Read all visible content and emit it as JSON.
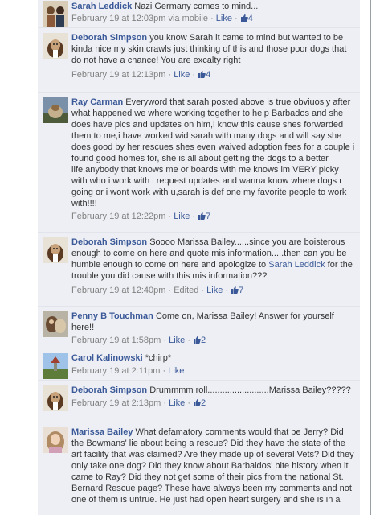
{
  "comments": [
    {
      "author": "Sarah Leddick",
      "text": "Nazi Germany comes to mind...",
      "meta": {
        "date": "February 19 at 12:03pm",
        "via": "via mobile",
        "like": "Like",
        "likes": "4"
      }
    },
    {
      "author": "Deborah Simpson",
      "text": "you know Sarah it came to mind but wanted to be kinda nice my skin crawls just thinking of this and those poor dogs that do not have a chance! You are excalty right",
      "meta": {
        "date": "February 19 at 12:13pm",
        "like": "Like",
        "likes": "4"
      }
    },
    {
      "author": "Ray Carman",
      "text": "Everyword that sarah posted above is true obviuosly after what happened we where working together to help Barbados and she does have pics and updates on him,i know this cause shes forwarded them to me,i have worked wid sarah with many dogs and will say she does good by her rescues shes even waived adoption fees for a couple i found good homes for, she is all about getting the dogs to a better life,anybody that knows me or boards with me knows im VERY picky with who i work with i request updates and wanna know where dogs r going or i wont work with u,sarah is def one my favorite people to work with!!!!",
      "meta": {
        "date": "February 19 at 12:22pm",
        "like": "Like",
        "likes": "7"
      }
    },
    {
      "author": "Deborah Simpson",
      "text_before": "Soooo Marissa Bailey......since you are boisterous enough to come on here and quote mis information.....then can you be humble enough to come on here and apologize to",
      "mention": "Sarah Leddick",
      "text_after": "for the trouble you did cause with this mis information???",
      "meta": {
        "date": "February 19 at 12:40pm",
        "edited": "Edited",
        "like": "Like",
        "likes": "7"
      }
    },
    {
      "author": "Penny B Touchman",
      "text": "Come on, Marissa Bailey! Answer for yourself here!!",
      "meta": {
        "date": "February 19 at 1:58pm",
        "like": "Like",
        "likes": "2"
      }
    },
    {
      "author": "Carol Kalinowski",
      "text": "*chirp*",
      "meta": {
        "date": "February 19 at 2:11pm",
        "like": "Like"
      }
    },
    {
      "author": "Deborah Simpson",
      "text": "Drummmm roll.........................Marissa Bailey?????",
      "meta": {
        "date": "February 19 at 2:13pm",
        "like": "Like",
        "likes": "2"
      }
    },
    {
      "author": "Marissa Bailey",
      "text": "What defamatory comments would that be Jerry? Did the Bowmans' lie about being a rescue? Did they have the state of the art facility that was claimed? Are they made up of several Vets? Did they only take one dog? Did they know about Barbaidos' bite history when it came to Ray? Did they not get some of their pics from the national St. Bernard Rescue page? These have always been my comments and not one of them is untrue. He just had open heart surgery and she is in a"
    }
  ],
  "sep": " · ",
  "colors": {
    "link": "#3b5998",
    "comment_bg": "#edeff4",
    "meta": "#808080"
  },
  "icons": {
    "like_count": "thumbs-up-icon"
  }
}
